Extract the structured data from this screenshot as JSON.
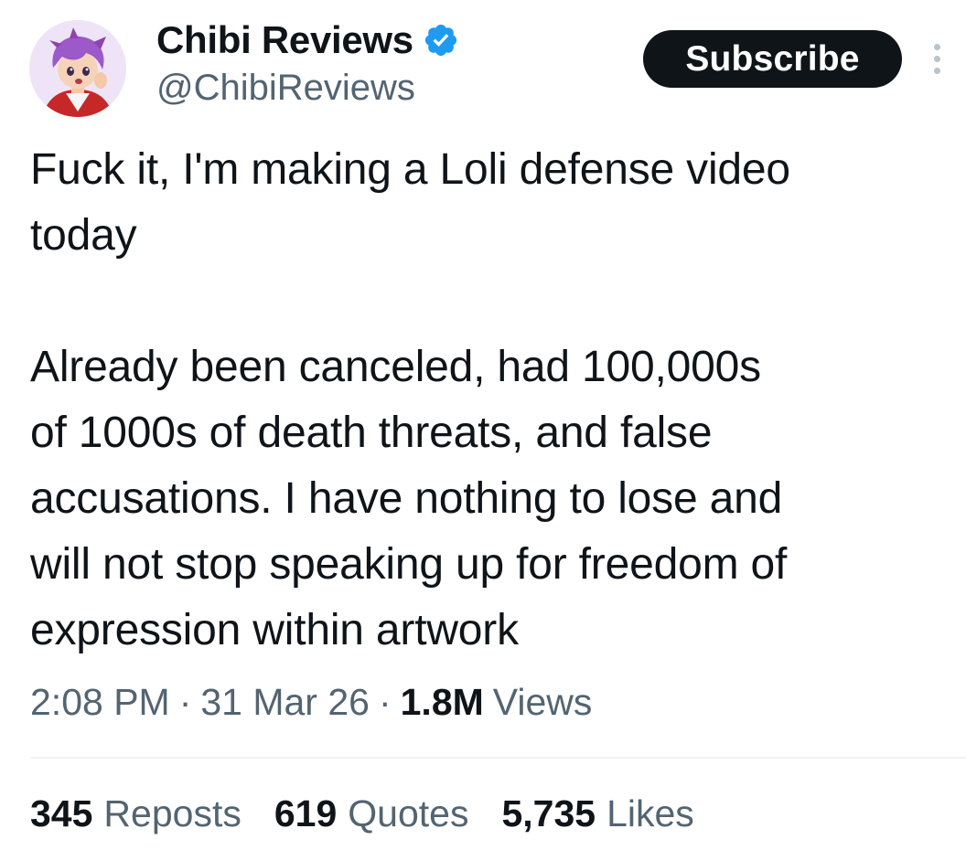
{
  "author": {
    "display_name": "Chibi Reviews",
    "handle": "@ChibiReviews",
    "avatar_icon": "anime-avatar-purple-hair",
    "verified": true,
    "verified_color": "#1d9bf0"
  },
  "actions": {
    "subscribe_label": "Subscribe",
    "more_icon": "vertical-ellipsis-icon"
  },
  "tweet": {
    "text": "Fuck it, I'm making a Loli defense video\ntoday\n\nAlready been canceled, had 100,000s\nof 1000s of death threats, and false\naccusations. I have nothing to lose and\nwill not stop speaking up for freedom of\nexpression within artwork"
  },
  "meta": {
    "time": "2:08 PM",
    "separator": "·",
    "date": "31 Mar 26",
    "views_count": "1.8M",
    "views_label": "Views"
  },
  "stats": {
    "reposts_count": "345",
    "reposts_label": "Reposts",
    "quotes_count": "619",
    "quotes_label": "Quotes",
    "likes_count": "5,735",
    "likes_label": "Likes"
  },
  "colors": {
    "text_primary": "#0f1419",
    "text_secondary": "#536471",
    "button_bg": "#0f1419",
    "divider": "#eff3f4"
  }
}
